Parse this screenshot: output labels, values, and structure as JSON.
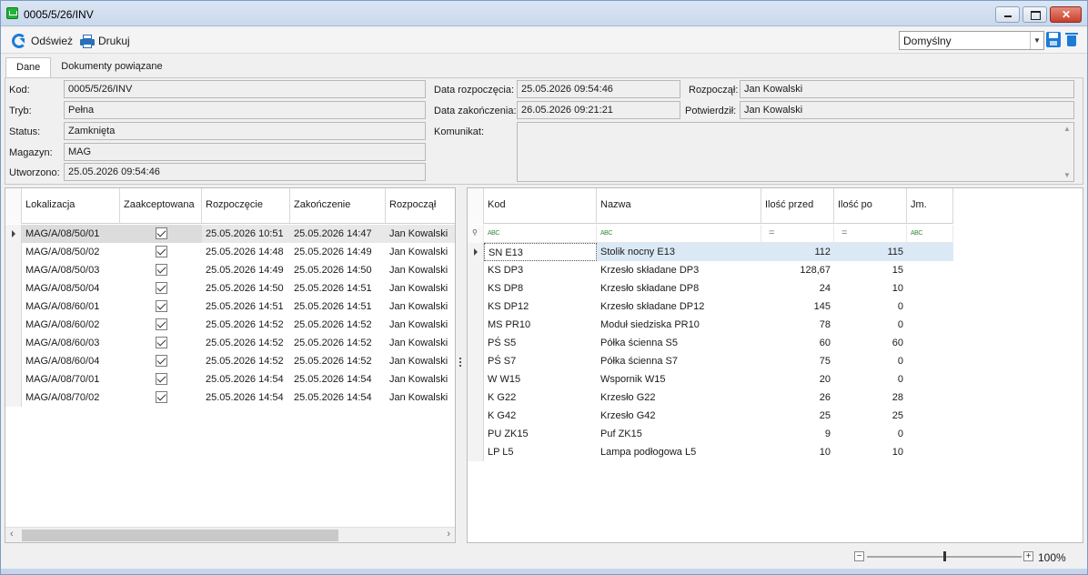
{
  "window": {
    "title": "0005/5/26/INV"
  },
  "toolbar": {
    "refresh_label": "Odśwież",
    "print_label": "Drukuj",
    "profile_value": "Domyślny"
  },
  "tabs": [
    {
      "label": "Dane"
    },
    {
      "label": "Dokumenty powiązane"
    }
  ],
  "form": {
    "kod": {
      "label": "Kod:",
      "value": "0005/5/26/INV"
    },
    "tryb": {
      "label": "Tryb:",
      "value": "Pełna"
    },
    "status": {
      "label": "Status:",
      "value": "Zamknięta"
    },
    "magazyn": {
      "label": "Magazyn:",
      "value": "MAG"
    },
    "utworzono": {
      "label": "Utworzono:",
      "value": "25.05.2026 09:54:46"
    },
    "data_rozpoczecia": {
      "label": "Data rozpoczęcia:",
      "value": "25.05.2026 09:54:46"
    },
    "data_zakonczenia": {
      "label": "Data zakończenia:",
      "value": "26.05.2026 09:21:21"
    },
    "komunikat": {
      "label": "Komunikat:",
      "value": ""
    },
    "rozpoczal": {
      "label": "Rozpoczął:",
      "value": "Jan Kowalski"
    },
    "potwierdzil": {
      "label": "Potwierdził:",
      "value": "Jan Kowalski"
    }
  },
  "left_grid": {
    "columns": [
      "Lokalizacja",
      "Zaakceptowana",
      "Rozpoczęcie",
      "Zakończenie",
      "Rozpoczął"
    ],
    "rows": [
      {
        "lokalizacja": "MAG/A/08/50/01",
        "zaakceptowana": true,
        "rozpoczecie": "25.05.2026 10:51",
        "zakonczenie": "25.05.2026 14:47",
        "rozpoczal": "Jan Kowalski"
      },
      {
        "lokalizacja": "MAG/A/08/50/02",
        "zaakceptowana": true,
        "rozpoczecie": "25.05.2026 14:48",
        "zakonczenie": "25.05.2026 14:49",
        "rozpoczal": "Jan Kowalski"
      },
      {
        "lokalizacja": "MAG/A/08/50/03",
        "zaakceptowana": true,
        "rozpoczecie": "25.05.2026 14:49",
        "zakonczenie": "25.05.2026 14:50",
        "rozpoczal": "Jan Kowalski"
      },
      {
        "lokalizacja": "MAG/A/08/50/04",
        "zaakceptowana": true,
        "rozpoczecie": "25.05.2026 14:50",
        "zakonczenie": "25.05.2026 14:51",
        "rozpoczal": "Jan Kowalski"
      },
      {
        "lokalizacja": "MAG/A/08/60/01",
        "zaakceptowana": true,
        "rozpoczecie": "25.05.2026 14:51",
        "zakonczenie": "25.05.2026 14:51",
        "rozpoczal": "Jan Kowalski"
      },
      {
        "lokalizacja": "MAG/A/08/60/02",
        "zaakceptowana": true,
        "rozpoczecie": "25.05.2026 14:52",
        "zakonczenie": "25.05.2026 14:52",
        "rozpoczal": "Jan Kowalski"
      },
      {
        "lokalizacja": "MAG/A/08/60/03",
        "zaakceptowana": true,
        "rozpoczecie": "25.05.2026 14:52",
        "zakonczenie": "25.05.2026 14:52",
        "rozpoczal": "Jan Kowalski"
      },
      {
        "lokalizacja": "MAG/A/08/60/04",
        "zaakceptowana": true,
        "rozpoczecie": "25.05.2026 14:52",
        "zakonczenie": "25.05.2026 14:52",
        "rozpoczal": "Jan Kowalski"
      },
      {
        "lokalizacja": "MAG/A/08/70/01",
        "zaakceptowana": true,
        "rozpoczecie": "25.05.2026 14:54",
        "zakonczenie": "25.05.2026 14:54",
        "rozpoczal": "Jan Kowalski"
      },
      {
        "lokalizacja": "MAG/A/08/70/02",
        "zaakceptowana": true,
        "rozpoczecie": "25.05.2026 14:54",
        "zakonczenie": "25.05.2026 14:54",
        "rozpoczal": "Jan Kowalski"
      }
    ]
  },
  "right_grid": {
    "columns": [
      "Kod",
      "Nazwa",
      "Ilość przed",
      "Ilość po",
      "Jm."
    ],
    "rows": [
      {
        "kod": "SN E13",
        "nazwa": "Stolik nocny E13",
        "ilosc_przed": "112",
        "ilosc_po": "115",
        "jm": ""
      },
      {
        "kod": "KS DP3",
        "nazwa": "Krzesło składane DP3",
        "ilosc_przed": "128,67",
        "ilosc_po": "15",
        "jm": ""
      },
      {
        "kod": "KS DP8",
        "nazwa": "Krzesło składane DP8",
        "ilosc_przed": "24",
        "ilosc_po": "10",
        "jm": ""
      },
      {
        "kod": "KS DP12",
        "nazwa": "Krzesło składane DP12",
        "ilosc_przed": "145",
        "ilosc_po": "0",
        "jm": ""
      },
      {
        "kod": "MS PR10",
        "nazwa": "Moduł siedziska PR10",
        "ilosc_przed": "78",
        "ilosc_po": "0",
        "jm": ""
      },
      {
        "kod": "PŚ S5",
        "nazwa": "Półka ścienna S5",
        "ilosc_przed": "60",
        "ilosc_po": "60",
        "jm": ""
      },
      {
        "kod": "PŚ S7",
        "nazwa": "Półka ścienna S7",
        "ilosc_przed": "75",
        "ilosc_po": "0",
        "jm": ""
      },
      {
        "kod": "W W15",
        "nazwa": "Wspornik W15",
        "ilosc_przed": "20",
        "ilosc_po": "0",
        "jm": ""
      },
      {
        "kod": "K G22",
        "nazwa": "Krzesło G22",
        "ilosc_przed": "26",
        "ilosc_po": "28",
        "jm": ""
      },
      {
        "kod": "K G42",
        "nazwa": "Krzesło G42",
        "ilosc_przed": "25",
        "ilosc_po": "25",
        "jm": ""
      },
      {
        "kod": "PU ZK15",
        "nazwa": "Puf ZK15",
        "ilosc_przed": "9",
        "ilosc_po": "0",
        "jm": ""
      },
      {
        "kod": "LP L5",
        "nazwa": "Lampa podłogowa L5",
        "ilosc_przed": "10",
        "ilosc_po": "10",
        "jm": ""
      }
    ]
  },
  "statusbar": {
    "zoom": "100%"
  },
  "icons": {
    "app": "inventory-app-icon",
    "refresh": "refresh-icon",
    "print": "printer-icon",
    "save": "save-icon",
    "delete": "trash-icon",
    "filter": "filter-icon"
  },
  "colors": {
    "accent": "#1d7bd6",
    "selection": "#dbe9f7"
  }
}
